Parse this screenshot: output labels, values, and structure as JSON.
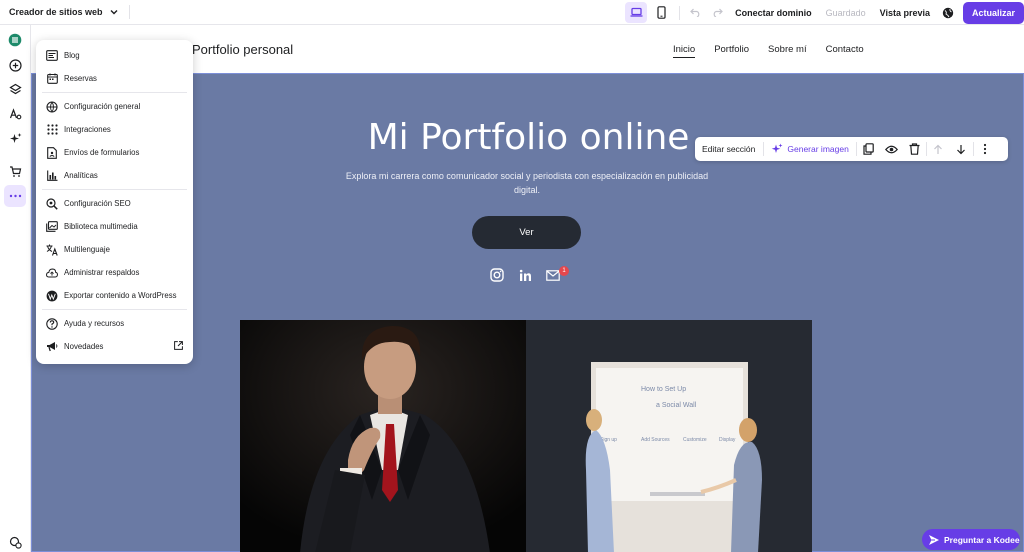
{
  "topbar": {
    "brand": "Creador de sitios web",
    "connect_domain": "Conectar dominio",
    "saved": "Guardado",
    "preview": "Vista previa",
    "update": "Actualizar"
  },
  "site": {
    "title": "Portfolio personal",
    "nav": [
      "Inicio",
      "Portfolio",
      "Sobre mí",
      "Contacto"
    ]
  },
  "hero": {
    "title": "Mi Portfolio online",
    "subtitle": "Explora mi carrera como comunicador social y periodista con especialización en publicidad digital.",
    "button": "Ver",
    "mail_badge": "1"
  },
  "whiteboard": {
    "line1": "How to Set Up",
    "line2": "a Social Wall",
    "cols": [
      "Sign up",
      "Add Sources",
      "Customize",
      "Display"
    ]
  },
  "section_toolbar": {
    "edit": "Editar sección",
    "generate": "Generar imagen"
  },
  "menu": {
    "group1": [
      "Blog",
      "Reservas"
    ],
    "group2": [
      "Configuración general",
      "Integraciones",
      "Envíos de formularios",
      "Analíticas"
    ],
    "group3": [
      "Configuración SEO",
      "Biblioteca multimedia",
      "Multilenguaje",
      "Administrar respaldos",
      "Exportar contenido a WordPress"
    ],
    "group4": [
      "Ayuda y recursos",
      "Novedades"
    ]
  },
  "kodee": "Preguntar a Kodee",
  "colors": {
    "accent": "#673de6",
    "hero_bg": "#6a7aa4",
    "button_dark": "#252a33"
  }
}
